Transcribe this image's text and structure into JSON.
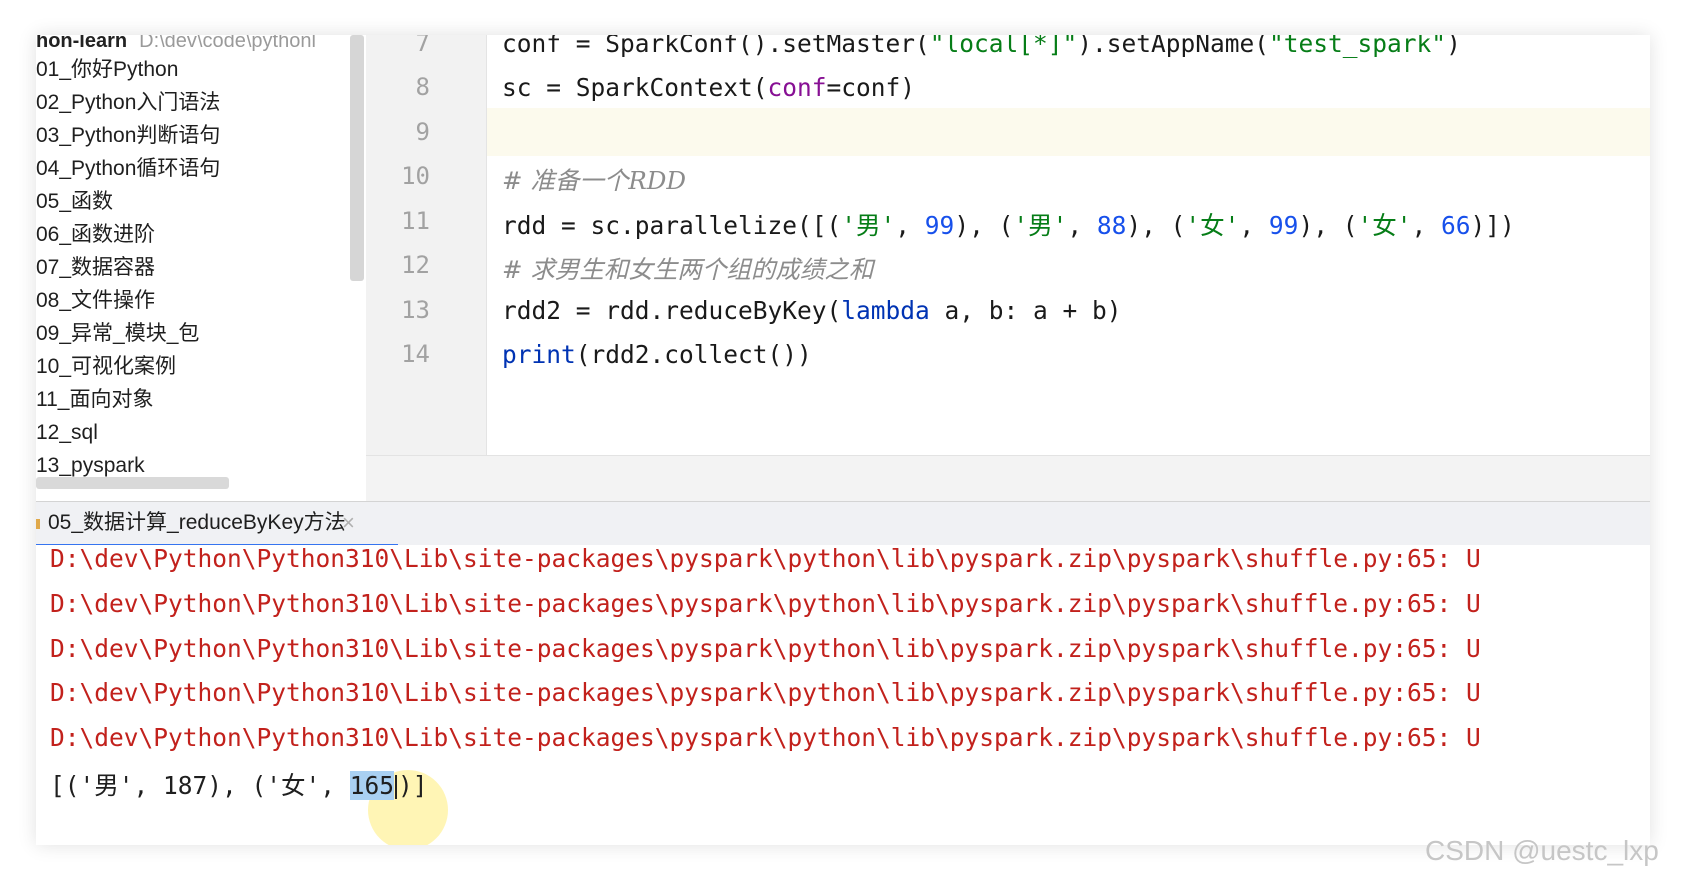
{
  "project": {
    "name": "hon-learn",
    "path": "D:\\dev\\code\\pythonl",
    "items": [
      "01_你好Python",
      "02_Python入门语法",
      "03_Python判断语句",
      "04_Python循环语句",
      "05_函数",
      "06_函数进阶",
      "07_数据容器",
      "08_文件操作",
      "09_异常_模块_包",
      "10_可视化案例",
      "11_面向对象",
      "12_sql",
      "13_pyspark"
    ]
  },
  "editor": {
    "line_numbers": [
      "7",
      "8",
      "9",
      "10",
      "11",
      "12",
      "13",
      "14"
    ],
    "code": {
      "l7_a": "conf = SparkConf().setMaster(",
      "l7_s1": "\"local[*]\"",
      "l7_b": ").setAppName(",
      "l7_s2": "\"test_spark\"",
      "l7_c": ")",
      "l8_a": "sc = SparkContext(",
      "l8_p": "conf",
      "l8_b": "=conf)",
      "l10": "# 准备一个RDD",
      "l11_a": "rdd = sc.parallelize([(",
      "l11_s1": "'男'",
      "l11_sep1": ", ",
      "l11_n1": "99",
      "l11_b": "), (",
      "l11_s2": "'男'",
      "l11_sep2": ", ",
      "l11_n2": "88",
      "l11_c": "), (",
      "l11_s3": "'女'",
      "l11_sep3": ", ",
      "l11_n3": "99",
      "l11_d": "), (",
      "l11_s4": "'女'",
      "l11_sep4": ", ",
      "l11_n4": "66",
      "l11_e": ")])",
      "l12": "# 求男生和女生两个组的成绩之和",
      "l13_a": "rdd2 = rdd.reduceByKey(",
      "l13_kw": "lambda",
      "l13_b": " a, b: a + b)",
      "l14_kw": "print",
      "l14_a": "(rdd2.collect())"
    }
  },
  "run_panel": {
    "tab_label": "05_数据计算_reduceByKey方法",
    "tab_close": "×",
    "warning_line": "D:\\dev\\Python\\Python310\\Lib\\site-packages\\pyspark\\python\\lib\\pyspark.zip\\pyspark\\shuffle.py:65: U",
    "warning_count": 5,
    "result_prefix": "[('男', 187), ('女', ",
    "result_highlight": "165",
    "result_suffix": ")]"
  },
  "watermark": "CSDN @uestc_lxp"
}
